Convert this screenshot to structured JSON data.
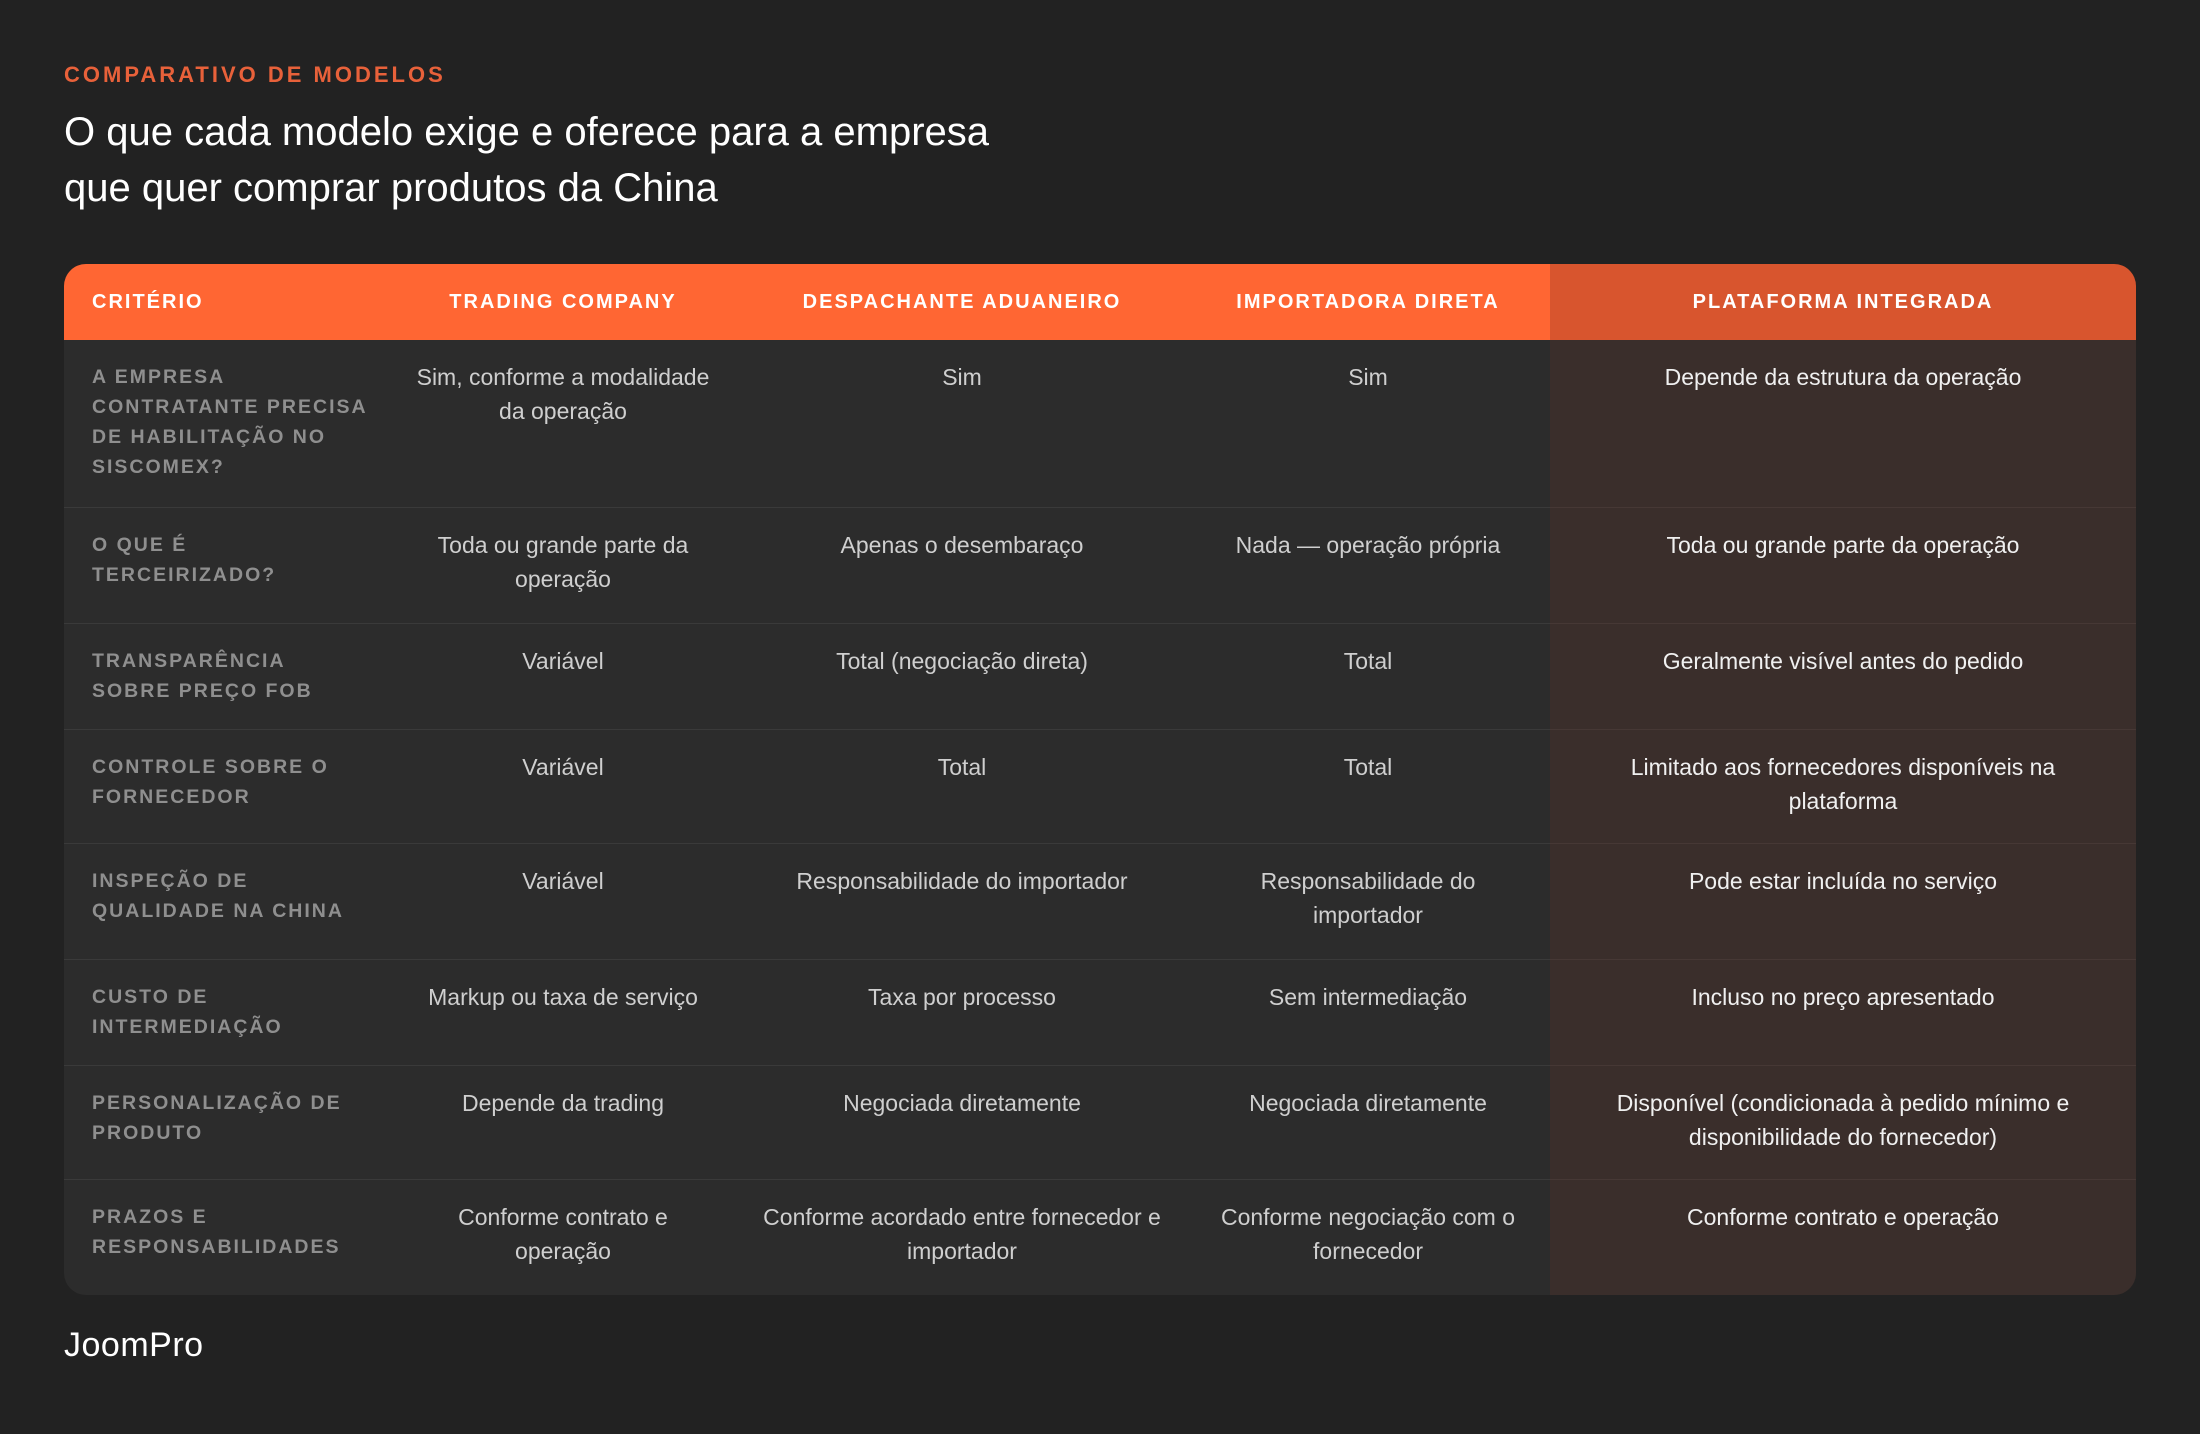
{
  "header": {
    "eyebrow": "COMPARATIVO DE MODELOS",
    "title_line1": "O que cada modelo exige e oferece para a empresa",
    "title_line2": "que quer comprar produtos da China"
  },
  "table": {
    "columns": [
      "CRITÉRIO",
      "TRADING COMPANY",
      "DESPACHANTE ADUANEIRO",
      "IMPORTADORA DIRETA",
      "PLATAFORMA INTEGRADA"
    ],
    "rows": [
      {
        "criterion": "A EMPRESA CONTRATANTE PRECISA DE HABILITAÇÃO NO SISCOMEX?",
        "trading": "Sim, conforme a modalidade da operação",
        "despachante": "Sim",
        "importadora": "Sim",
        "plataforma": "Depende da estrutura da operação"
      },
      {
        "criterion": "O QUE É TERCEIRIZADO?",
        "trading": "Toda ou grande parte da operação",
        "despachante": "Apenas o desembaraço",
        "importadora": "Nada — operação própria",
        "plataforma": "Toda ou grande parte da operação"
      },
      {
        "criterion": "TRANSPARÊNCIA SOBRE PREÇO FOB",
        "trading": "Variável",
        "despachante": "Total (negociação direta)",
        "importadora": "Total",
        "plataforma": "Geralmente visível antes do pedido"
      },
      {
        "criterion": "CONTROLE SOBRE O FORNECEDOR",
        "trading": "Variável",
        "despachante": "Total",
        "importadora": "Total",
        "plataforma": "Limitado aos fornecedores disponíveis na plataforma"
      },
      {
        "criterion": "INSPEÇÃO DE QUALIDADE NA CHINA",
        "trading": "Variável",
        "despachante": "Responsabilidade do importador",
        "importadora": "Responsabilidade do importador",
        "plataforma": "Pode estar incluída no serviço"
      },
      {
        "criterion": "CUSTO DE INTERMEDIAÇÃO",
        "trading": "Markup ou taxa de serviço",
        "despachante": "Taxa por processo",
        "importadora": "Sem intermediação",
        "plataforma": "Incluso no preço apresentado"
      },
      {
        "criterion": "PERSONALIZAÇÃO DE PRODUTO",
        "trading": "Depende da trading",
        "despachante": "Negociada diretamente",
        "importadora": "Negociada diretamente",
        "plataforma": "Disponível (condicionada à pedido mínimo e disponibilidade do fornecedor)"
      },
      {
        "criterion": "PRAZOS E RESPONSABILIDADES",
        "trading": "Conforme contrato e operação",
        "despachante": "Conforme acordado entre fornecedor e importador",
        "importadora": "Conforme negociação com o fornecedor",
        "plataforma": "Conforme contrato e operação"
      }
    ]
  },
  "footer": {
    "logo": "JoomPro"
  },
  "colors": {
    "background": "#222222",
    "accent": "#ff6633",
    "accent_dark": "#d8552e",
    "eyebrow": "#e8613a",
    "highlight_column": "#3a2e2b"
  }
}
